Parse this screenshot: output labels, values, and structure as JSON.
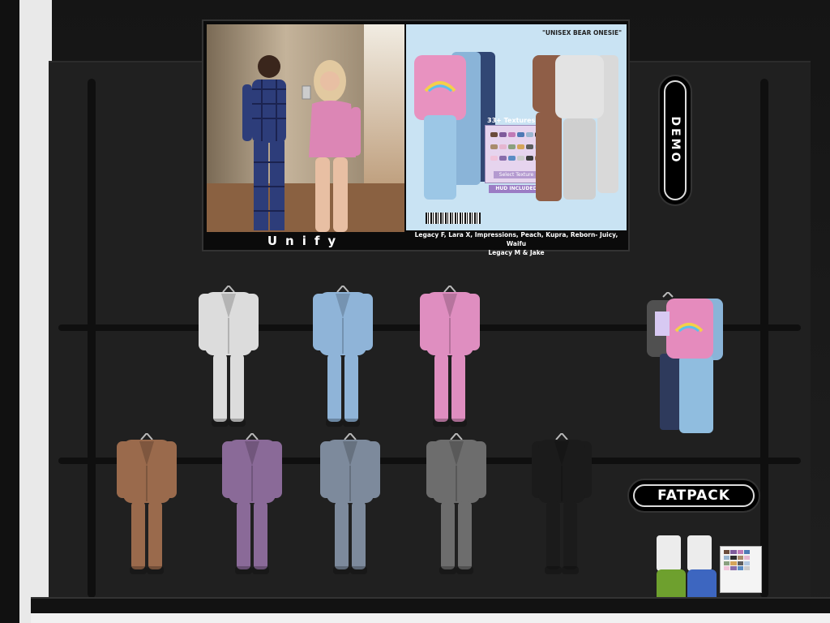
{
  "tv": {
    "caption": "Unify",
    "product_title": "\"UNISEX BEAR ONESIE\"",
    "hud_title": "33+ Textures",
    "hud_button": "Select Texture",
    "hud_footer": "HUD INCLUDED",
    "bodies_line1": "Legacy F, Lara X, Impressions, Peach, Kupra, Reborn- Juicy, Waifu",
    "bodies_line2": "Legacy M & Jake"
  },
  "buttons": {
    "demo_label": "DEMO",
    "fatpack_label": "FATPACK"
  },
  "colors": {
    "hud_swatches": [
      "#6b4c3b",
      "#7e5b9b",
      "#c07ab6",
      "#4e79b5",
      "#9ab6d1",
      "#2d2d2d",
      "#a88b6c",
      "#e6b6d0",
      "#8aa07f",
      "#d5a55b",
      "#5d5d5d",
      "#b3c9e2",
      "#f0c3da",
      "#886dab",
      "#5b8cc4",
      "#cccccc",
      "#3c3c3c",
      "#9a7c5e"
    ]
  },
  "outfits": [
    {
      "name": "white",
      "color": "#dcdcdc"
    },
    {
      "name": "light-blue",
      "color": "#8fb4d8"
    },
    {
      "name": "pink",
      "color": "#df8ec0"
    },
    {
      "name": "brown",
      "color": "#9a6a4c"
    },
    {
      "name": "purple",
      "color": "#8a6a98"
    },
    {
      "name": "slate",
      "color": "#7d8a9c"
    },
    {
      "name": "grey",
      "color": "#6d6d6d"
    },
    {
      "name": "black",
      "color": "#1b1b1b"
    }
  ]
}
